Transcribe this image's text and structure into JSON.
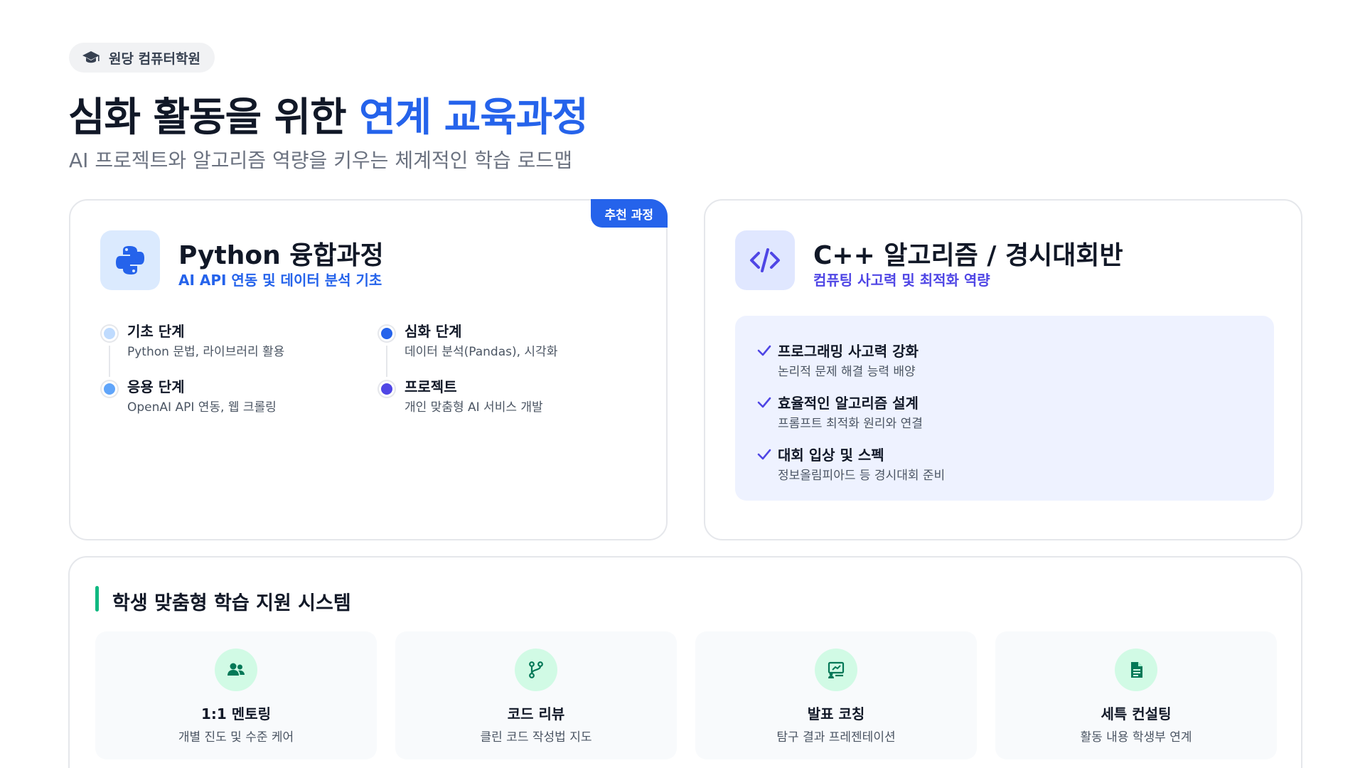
{
  "header": {
    "badge_label": "원당 컴퓨터학원",
    "title_main": "심화 활동을 위한 ",
    "title_accent": "연계 교육과정",
    "subtitle": "AI 프로젝트와 알고리즘 역량을 키우는 체계적인 학습 로드맵"
  },
  "python_course": {
    "tag": "추천 과정",
    "title": "Python 융합과정",
    "subtitle": "AI API 연동 및 데이터 분석 기초",
    "icon": "python-icon",
    "steps": [
      {
        "title": "기초 단계",
        "desc": "Python 문법, 라이브러리 활용",
        "color": "#bfdbfe"
      },
      {
        "title": "응용 단계",
        "desc": "OpenAI API 연동, 웹 크롤링",
        "color": "#60a5fa"
      },
      {
        "title": "심화 단계",
        "desc": "데이터 분석(Pandas), 시각화",
        "color": "#2563eb"
      },
      {
        "title": "프로젝트",
        "desc": "개인 맞춤형 AI 서비스 개발",
        "color": "#4f46e5"
      }
    ]
  },
  "cpp_course": {
    "title": "C++ 알고리즘 / 경시대회반",
    "subtitle": "컴퓨팅 사고력 및 최적화 역량",
    "icon": "code-icon",
    "checks": [
      {
        "title": "프로그래밍 사고력 강화",
        "desc": "논리적 문제 해결 능력 배양"
      },
      {
        "title": "효율적인 알고리즘 설계",
        "desc": "프롬프트 최적화 원리와 연결"
      },
      {
        "title": "대회 입상 및 스펙",
        "desc": "정보올림피아드 등 경시대회 준비"
      }
    ]
  },
  "support": {
    "title": "학생 맞춤형 학습 지원 시스템",
    "items": [
      {
        "title": "1:1 멘토링",
        "desc": "개별 진도 및 수준 케어",
        "icon": "users-icon"
      },
      {
        "title": "코드 리뷰",
        "desc": "클린 코드 작성법 지도",
        "icon": "code-branch-icon"
      },
      {
        "title": "발표 코칭",
        "desc": "탐구 결과 프레젠테이션",
        "icon": "presentation-icon"
      },
      {
        "title": "세특 컨설팅",
        "desc": "활동 내용 학생부 연계",
        "icon": "document-icon"
      }
    ]
  },
  "colors": {
    "accent_blue": "#2563eb",
    "accent_indigo": "#4f46e5",
    "accent_green": "#10b981"
  }
}
